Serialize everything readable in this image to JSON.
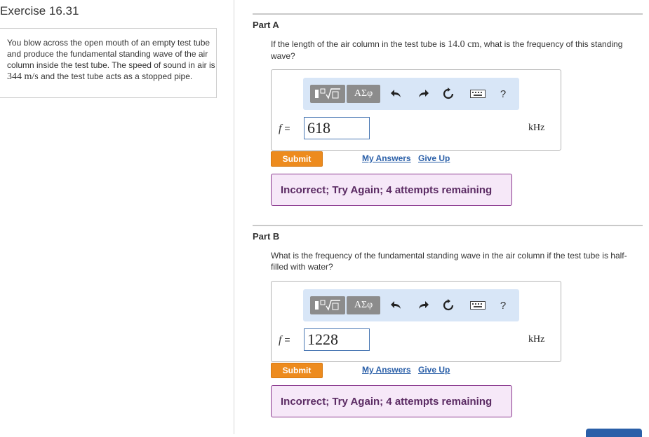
{
  "exercise_title": "Exercise 16.31",
  "problem_text": {
    "p1": "You blow across the open mouth of an empty test tube and produce the fundamental standing wave of the air column inside the test tube. The speed of sound in air is ",
    "speed_value": "344 m/s",
    "p2": " and the test tube acts as a stopped pipe."
  },
  "parts": [
    {
      "title": "Part A",
      "question_pre": "If the length of the air column in the test tube is ",
      "question_value": "14.0 cm",
      "question_post": ", what is the frequency of this standing wave?",
      "variable": "f",
      "equals": "=",
      "answer_value": "618",
      "unit": "kHz",
      "submit_label": "Submit",
      "my_answers_label": "My Answers",
      "give_up_label": "Give Up",
      "feedback": "Incorrect; Try Again; 4 attempts remaining"
    },
    {
      "title": "Part B",
      "question": "What is the frequency of the fundamental standing wave in the air column if the test tube is half-filled with water?",
      "variable": "f",
      "equals": "=",
      "answer_value": "1228",
      "unit": "kHz",
      "submit_label": "Submit",
      "my_answers_label": "My Answers",
      "give_up_label": "Give Up",
      "feedback": "Incorrect; Try Again; 4 attempts remaining"
    }
  ],
  "toolbar": {
    "greek_label": "ΑΣφ",
    "help_label": "?",
    "icons": [
      "templates-icon",
      "greek-symbols-icon",
      "undo-icon",
      "redo-icon",
      "reset-icon",
      "keyboard-icon",
      "help-icon"
    ]
  },
  "colors": {
    "submit": "#ed8b1e",
    "link": "#2a5fa8",
    "feedback_border": "#8b3a8f",
    "feedback_bg": "#f6e8f8",
    "toolbar_bg": "#d8e6f7"
  }
}
